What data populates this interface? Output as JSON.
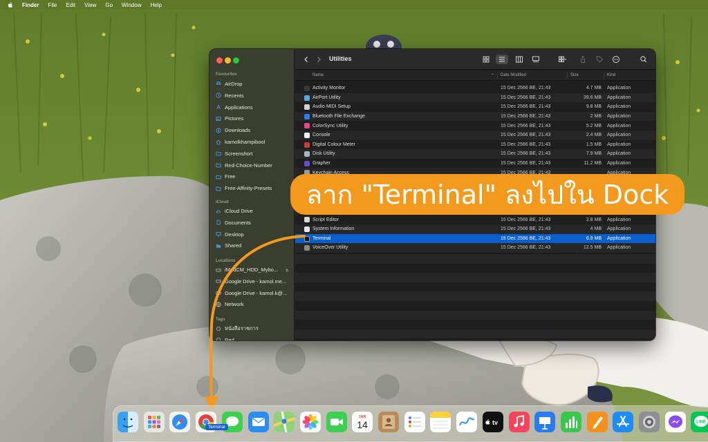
{
  "menubar": {
    "app": "Finder",
    "items": [
      "File",
      "Edit",
      "View",
      "Go",
      "Window",
      "Help"
    ]
  },
  "finder": {
    "title": "Utilities",
    "sidebar": {
      "favourites_label": "Favourites",
      "favourites": [
        {
          "label": "AirDrop",
          "icon": "airdrop-icon"
        },
        {
          "label": "Recents",
          "icon": "clock-icon"
        },
        {
          "label": "Applications",
          "icon": "applications-icon"
        },
        {
          "label": "Pictures",
          "icon": "pictures-icon"
        },
        {
          "label": "Downloads",
          "icon": "downloads-icon"
        },
        {
          "label": "kamolkhampibool",
          "icon": "home-icon"
        },
        {
          "label": "Screenshort",
          "icon": "folder-icon"
        },
        {
          "label": "Red-Choice-Number",
          "icon": "folder-icon"
        },
        {
          "label": "Free",
          "icon": "folder-icon"
        },
        {
          "label": "Free-Affinity-Presets",
          "icon": "folder-icon"
        }
      ],
      "icloud_label": "iCloud",
      "icloud": [
        {
          "label": "iCloud Drive",
          "icon": "cloud-icon"
        },
        {
          "label": "Documents",
          "icon": "document-icon"
        },
        {
          "label": "Desktop",
          "icon": "desktop-icon"
        },
        {
          "label": "Shared",
          "icon": "shared-folder-icon"
        }
      ],
      "locations_label": "Locations",
      "locations": [
        {
          "label": "iModCM_HDD_Mybo...",
          "icon": "drive-icon"
        },
        {
          "label": "Google Drive - kamol.me...",
          "icon": "drive-icon"
        },
        {
          "label": "Google Drive - kamol.k@...",
          "icon": "drive-icon"
        },
        {
          "label": "Network",
          "icon": "network-icon"
        }
      ],
      "tags_label": "Tags",
      "tags": [
        {
          "label": "หนังสือราชการ",
          "icon": "tag-icon"
        },
        {
          "label": "Red",
          "icon": "tag-icon"
        }
      ]
    },
    "columns": {
      "name": "Name",
      "date": "Date Modified",
      "size": "Size",
      "kind": "Kind"
    },
    "rows": [
      {
        "name": "Activity Monitor",
        "date": "15 Dec 2566 BE, 21:43",
        "size": "4.7 MB",
        "kind": "Application",
        "color": "#3a3a3a"
      },
      {
        "name": "AirPort Utility",
        "date": "15 Dec 2566 BE, 21:43",
        "size": "39.6 MB",
        "kind": "Application",
        "color": "#5aa9e6"
      },
      {
        "name": "Audio MIDI Setup",
        "date": "15 Dec 2566 BE, 21:43",
        "size": "9.8 MB",
        "kind": "Application",
        "color": "#d0d0d0"
      },
      {
        "name": "Bluetooth File Exchange",
        "date": "15 Dec 2566 BE, 21:43",
        "size": "2 MB",
        "kind": "Application",
        "color": "#2d7cf6"
      },
      {
        "name": "ColorSync Utility",
        "date": "15 Dec 2566 BE, 21:43",
        "size": "5.2 MB",
        "kind": "Application",
        "color": "#e34a8a"
      },
      {
        "name": "Console",
        "date": "15 Dec 2566 BE, 21:43",
        "size": "2.4 MB",
        "kind": "Application",
        "color": "#f0f0f0"
      },
      {
        "name": "Digital Colour Meter",
        "date": "15 Dec 2566 BE, 21:43",
        "size": "1.5 MB",
        "kind": "Application",
        "color": "#c94030"
      },
      {
        "name": "Disk Utility",
        "date": "15 Dec 2566 BE, 21:43",
        "size": "7.9 MB",
        "kind": "Application",
        "color": "#a8b4c0"
      },
      {
        "name": "Grapher",
        "date": "15 Dec 2566 BE, 21:43",
        "size": "11.2 MB",
        "kind": "Application",
        "color": "#6a4ccf"
      },
      {
        "name": "Keychain Access",
        "date": "15 Dec 2566 BE, 21:43",
        "size": "",
        "kind": "Application",
        "color": "#9a9a9a"
      },
      {
        "name": "",
        "date": "",
        "size": "",
        "kind": "",
        "color": "#262626"
      },
      {
        "name": "",
        "date": "",
        "size": "",
        "kind": "",
        "color": "#1e1e1e"
      },
      {
        "name": "",
        "date": "",
        "size": "",
        "kind": "",
        "color": "#262626"
      },
      {
        "name": "",
        "date": "",
        "size": "",
        "kind": "",
        "color": "#1e1e1e"
      },
      {
        "name": "Script Editor",
        "date": "15 Dec 2566 BE, 21:43",
        "size": "2.8 MB",
        "kind": "Application",
        "color": "#d8d8d8"
      },
      {
        "name": "System Information",
        "date": "15 Dec 2566 BE, 21:43",
        "size": "4 MB",
        "kind": "Application",
        "color": "#e8e8e8"
      },
      {
        "name": "Terminal",
        "date": "15 Dec 2566 BE, 21:43",
        "size": "6.9 MB",
        "kind": "Application",
        "color": "#111111",
        "selected": true
      },
      {
        "name": "VoiceOver Utility",
        "date": "15 Dec 2566 BE, 21:43",
        "size": "12.5 MB",
        "kind": "Application",
        "color": "#8a8a8a"
      }
    ]
  },
  "annotation": {
    "text": "ลาก \"Terminal\" ลงไปใน Dock",
    "color": "#f39a1e"
  },
  "dock": {
    "drag_label": "Terminal",
    "icons": [
      "finder-icon",
      "launchpad-icon",
      "safari-icon",
      "chrome-icon",
      "messages-icon",
      "mail-icon",
      "maps-icon",
      "photos-icon",
      "facetime-icon",
      "calendar-icon",
      "contacts-icon",
      "reminders-icon",
      "notes-icon",
      "freeform-icon",
      "apple-tv-icon",
      "music-icon",
      "keynote-icon",
      "numbers-icon",
      "pages-icon",
      "app-store-icon",
      "system-settings-icon",
      "messenger-icon",
      "line-icon"
    ],
    "calendar": {
      "month": "JAN",
      "day": "14"
    },
    "tv_label": "tv"
  }
}
